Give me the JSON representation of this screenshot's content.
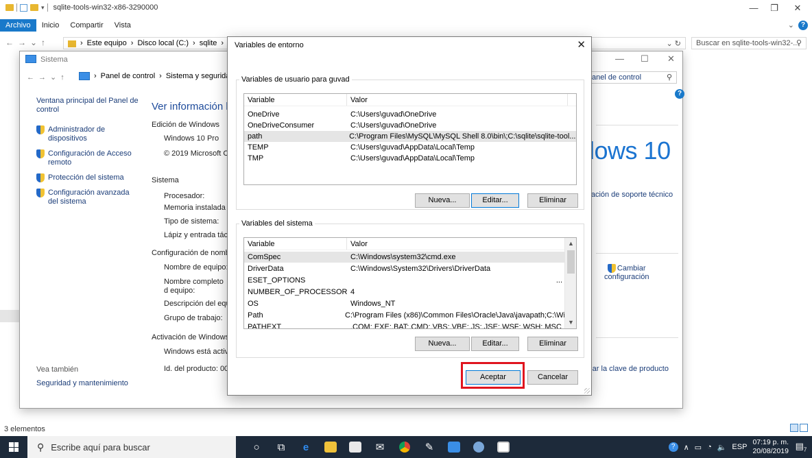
{
  "explorer": {
    "title": "sqlite-tools-win32-x86-3290000",
    "tabs": [
      "Archivo",
      "Inicio",
      "Compartir",
      "Vista"
    ],
    "breadcrumb": [
      "Este equipo",
      "Disco local (C:)",
      "sqlite",
      "sqlite-tools-win32-x86-3290000"
    ],
    "search_placeholder": "Buscar en sqlite-tools-win32-...",
    "status": "3 elementos"
  },
  "sistema": {
    "title": "Sistema",
    "breadcrumb": [
      "Panel de control",
      "Sistema y segurida"
    ],
    "search_placeholder": "el Panel de control",
    "sidebar": {
      "home": "Ventana principal del Panel de control",
      "items": [
        "Administrador de dispositivos",
        "Configuración de Acceso remoto",
        "Protección del sistema",
        "Configuración avanzada del sistema"
      ]
    },
    "see_also": "Vea también",
    "security_link": "Seguridad y mantenimiento",
    "main_title": "Ver información b",
    "edition_header": "Edición de Windows",
    "edition": "Windows 10 Pro",
    "copyright": "© 2019 Microsoft C",
    "windows10": "dows 10",
    "support_link": "rmación de soporte técnico",
    "system_header": "Sistema",
    "system_labels": [
      "Procesador:",
      "Memoria instalada (",
      "Tipo de sistema:",
      "Lápiz y entrada tácti"
    ],
    "config_header": "Configuración de nomb",
    "config_labels": [
      "Nombre de equipo:",
      "Nombre completo d equipo:",
      "Descripción del equ",
      "Grupo de trabajo:"
    ],
    "change_config": [
      "Cambiar",
      "configuración"
    ],
    "activation_header": "Activación de Windows",
    "activation_status": "Windows está activa",
    "product_id": "Id. del producto: 00",
    "product_key_link": "nbiar la clave de producto"
  },
  "dialog": {
    "title": "Variables de entorno",
    "user_group": "Variables de usuario para guvad",
    "system_group": "Variables del sistema",
    "col_variable": "Variable",
    "col_value": "Valor",
    "user_vars": [
      {
        "name": "OneDrive",
        "value": "C:\\Users\\guvad\\OneDrive"
      },
      {
        "name": "OneDriveConsumer",
        "value": "C:\\Users\\guvad\\OneDrive"
      },
      {
        "name": "path",
        "value": "C:\\Program Files\\MySQL\\MySQL Shell 8.0\\bin\\;C:\\sqlite\\sqlite-tool..."
      },
      {
        "name": "TEMP",
        "value": "C:\\Users\\guvad\\AppData\\Local\\Temp"
      },
      {
        "name": "TMP",
        "value": "C:\\Users\\guvad\\AppData\\Local\\Temp"
      }
    ],
    "system_vars": [
      {
        "name": "ComSpec",
        "value": "C:\\Windows\\system32\\cmd.exe"
      },
      {
        "name": "DriverData",
        "value": "C:\\Windows\\System32\\Drivers\\DriverData"
      },
      {
        "name": "ESET_OPTIONS",
        "value": "..."
      },
      {
        "name": "NUMBER_OF_PROCESSORS",
        "value": "4"
      },
      {
        "name": "OS",
        "value": "Windows_NT"
      },
      {
        "name": "Path",
        "value": "C:\\Program Files (x86)\\Common Files\\Oracle\\Java\\javapath;C:\\Win..."
      },
      {
        "name": "PATHEXT",
        "value": ".COM;.EXE;.BAT;.CMD;.VBS;.VBE;.JS;.JSE;.WSF;.WSH;.MSC"
      }
    ],
    "btn_new": "Nueva...",
    "btn_edit": "Editar...",
    "btn_delete": "Eliminar",
    "btn_ok": "Aceptar",
    "btn_cancel": "Cancelar"
  },
  "taskbar": {
    "search_placeholder": "Escribe aquí para buscar",
    "language": "ESP",
    "time": "07:19 p. m.",
    "date": "20/08/2019",
    "notification_count": "7"
  },
  "colors": {
    "accent": "#1979ca",
    "highlight": "#e0141e",
    "link": "#1a3c78",
    "taskbar": "#1d2a3a"
  }
}
